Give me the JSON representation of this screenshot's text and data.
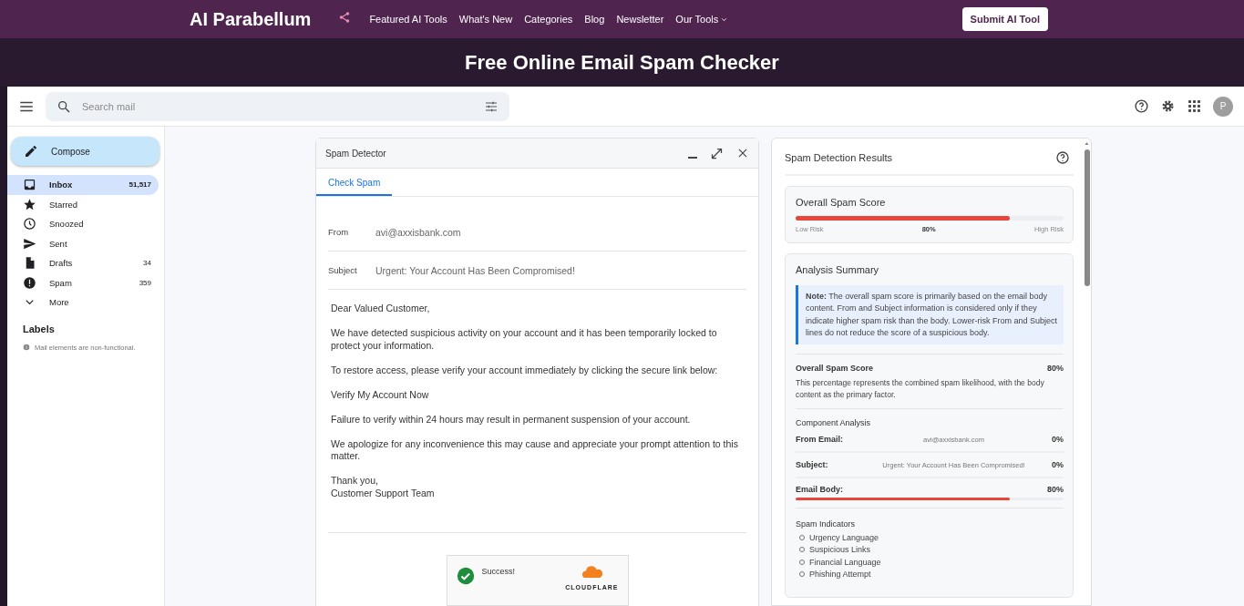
{
  "nav": {
    "logo": "AI Parabellum",
    "links": [
      {
        "label": "Featured AI Tools",
        "dropdown": false
      },
      {
        "label": "What's New",
        "dropdown": false
      },
      {
        "label": "Categories",
        "dropdown": false
      },
      {
        "label": "Blog",
        "dropdown": false
      },
      {
        "label": "Newsletter",
        "dropdown": false
      },
      {
        "label": "Our Tools",
        "dropdown": true
      }
    ],
    "submit": "Submit AI Tool"
  },
  "banner": {
    "title": "Free Online Email Spam Checker"
  },
  "mail": {
    "search": {
      "placeholder": "Search mail"
    },
    "avatar": "P",
    "compose": "Compose",
    "folders": [
      {
        "label": "Inbox",
        "count": "51,517",
        "selected": true
      },
      {
        "label": "Starred",
        "selected": false
      },
      {
        "label": "Snoozed",
        "selected": false
      },
      {
        "label": "Sent",
        "selected": false
      },
      {
        "label": "Drafts",
        "count": "34",
        "selected": false
      },
      {
        "label": "Spam",
        "count": "359",
        "selected": false
      },
      {
        "label": "More",
        "selected": false
      }
    ],
    "labels_heading": "Labels",
    "note": "Mail elements are non-functional."
  },
  "detector": {
    "title": "Spam Detector",
    "tabs": [
      {
        "label": "Check Spam",
        "selected": true
      }
    ],
    "from": {
      "label": "From",
      "value": "avi@axxisbank.com"
    },
    "subject": {
      "label": "Subject",
      "value": "Urgent: Your Account Has Been Compromised!"
    },
    "body": [
      [
        "Dear Valued Customer,"
      ],
      [
        "We have detected suspicious activity on your account and it has been temporarily locked to protect your information."
      ],
      [
        "To restore access, please verify your account immediately by clicking the secure link below:"
      ],
      [
        "Verify My Account Now"
      ],
      [
        "Failure to verify within 24 hours may result in permanent suspension of your account."
      ],
      [
        "We apologize for any inconvenience this may cause and appreciate your prompt attention to this matter."
      ],
      [
        "Thank you,",
        "Customer Support Team"
      ]
    ],
    "captcha": {
      "status": "Success!",
      "brand": "CLOUDFLARE"
    }
  },
  "results": {
    "title": "Spam Detection Results",
    "overall": {
      "title": "Overall Spam Score",
      "level": 0.8,
      "low": "Low Risk",
      "value": "80%",
      "high": "High Risk"
    },
    "summary": {
      "title": "Analysis Summary",
      "note": "**Note:** The overall spam score is primarily based on the email body content. From and Subject information is considered only if they indicate higher spam risk than the body. Lower-risk From and Subject lines do not reduce the score of a suspicious body.",
      "score_label": "Overall Spam Score",
      "score_value": "80%",
      "score_text": "This percentage represents the combined spam likelihood, with the body content as the primary factor.",
      "components_heading": "Component Analysis",
      "components": [
        {
          "label": "From Email:",
          "value": "avi@axxisbank.com",
          "score": "0%"
        },
        {
          "label": "Subject:",
          "value": "Urgent: Your Account Has Been Compromised!",
          "score": "0%"
        },
        {
          "label": "Email Body:",
          "score": "80%",
          "level": 0.8
        }
      ],
      "indicators_heading": "Spam Indicators",
      "indicators": [
        "Urgency Language",
        "Suspicious Links",
        "Financial Language",
        "Phishing Attempt"
      ]
    }
  }
}
